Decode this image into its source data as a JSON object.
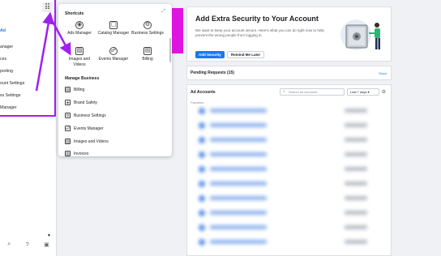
{
  "sidebar": {
    "items": [
      "Ad",
      "anager",
      "ces",
      "porting",
      "ount Settings",
      "ss Settings",
      "Manager"
    ],
    "bottom_icons": [
      "search-icon",
      "help-icon",
      "sidebar-toggle-icon"
    ]
  },
  "shortcuts_panel": {
    "title": "Shortcuts",
    "shortcuts": [
      {
        "label": "Ads Manager",
        "icon": "ads-manager-icon"
      },
      {
        "label": "Catalog Manager",
        "icon": "catalog-icon"
      },
      {
        "label": "Business Settings",
        "icon": "gear-icon"
      },
      {
        "label": "Images and Videos",
        "icon": "image-icon"
      },
      {
        "label": "Events Manager",
        "icon": "events-icon"
      },
      {
        "label": "Billing",
        "icon": "billing-icon"
      }
    ],
    "manage_title": "Manage Business",
    "manage_items": [
      {
        "label": "Billing",
        "icon": "billing-icon"
      },
      {
        "label": "Brand Safety",
        "icon": "shield-icon"
      },
      {
        "label": "Business Settings",
        "icon": "gear-icon"
      },
      {
        "label": "Events Manager",
        "icon": "events-icon"
      },
      {
        "label": "Images and Videos",
        "icon": "image-icon"
      },
      {
        "label": "Invoices",
        "icon": "invoice-icon"
      }
    ]
  },
  "security_card": {
    "title": "Add Extra Security to Your Account",
    "description": "We want to keep your account secure. Here's what you can do right now to help prevent the wrong people from logging in.",
    "primary_button": "Add Security",
    "secondary_button": "Remind Me Later"
  },
  "pending": {
    "title": "Pending Requests (15)",
    "show_label": "Show"
  },
  "ad_accounts": {
    "title": "Ad Accounts",
    "search_placeholder": "Search ad accounts",
    "date_range": "Last 7 days",
    "favorites_label": "Favorites"
  },
  "colors": {
    "accent": "#1877f2",
    "annotation_purple": "#a020f0",
    "magenta_strip": "#e014e0"
  }
}
